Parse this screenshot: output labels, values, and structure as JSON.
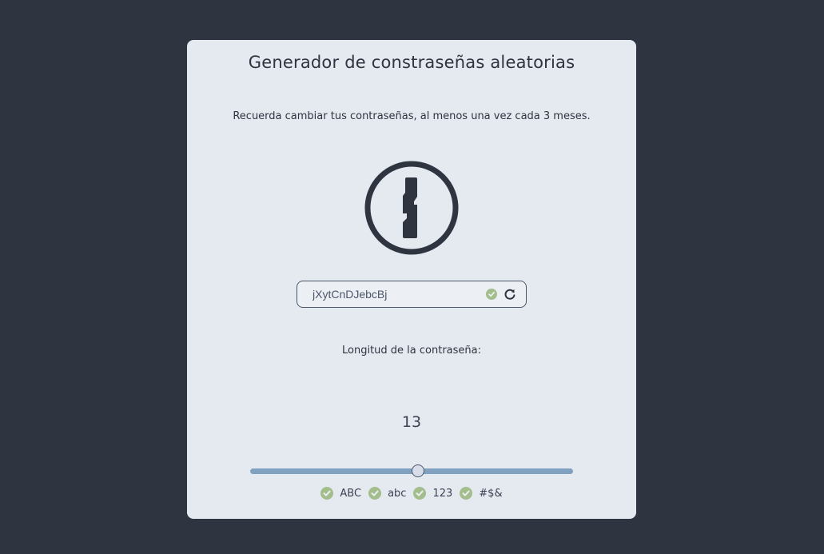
{
  "app": {
    "title": "Generador de constraseñas aleatorias",
    "subtitle": "Recuerda cambiar tus contraseñas, al menos una vez cada 3 meses.",
    "logo_icon": "keyhole-logo-icon"
  },
  "password": {
    "value": "jXytCnDJebcBj",
    "valid_icon": "check-circle-icon",
    "refresh_icon": "refresh-icon"
  },
  "length": {
    "label": "Longitud de la contraseña:",
    "value": "13",
    "slider_fraction": 0.52
  },
  "options": [
    {
      "label": "ABC",
      "checked": true
    },
    {
      "label": "abc",
      "checked": true
    },
    {
      "label": "123",
      "checked": true
    },
    {
      "label": "#$&",
      "checked": true
    }
  ],
  "colors": {
    "background": "#2e3440",
    "card": "#e5e9f0",
    "accent": "#81a1c1",
    "check": "#a3be8c"
  }
}
